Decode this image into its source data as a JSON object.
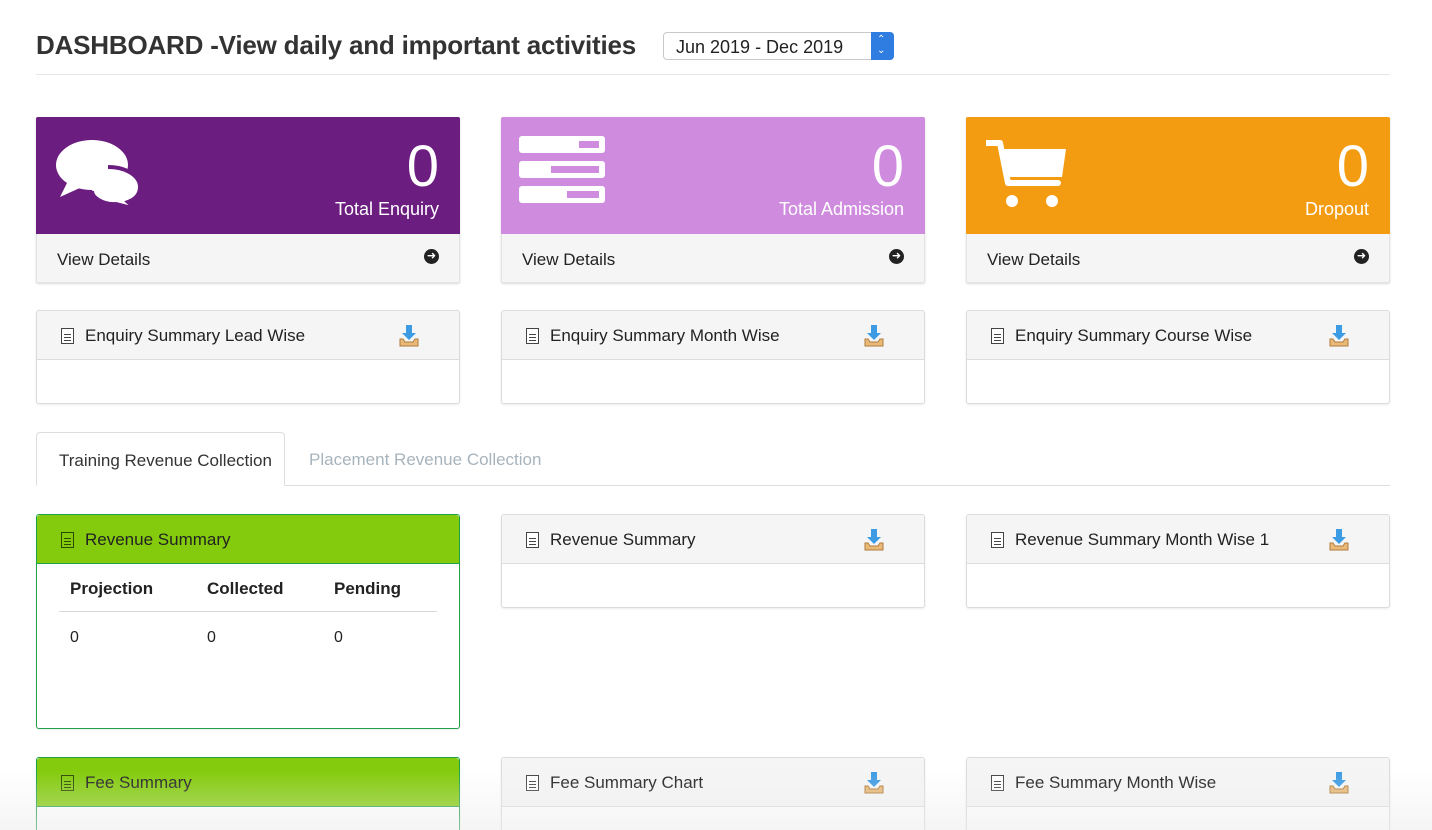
{
  "header": {
    "title": "DASHBOARD -View daily and important activities",
    "date_range": "Jun 2019 - Dec 2019"
  },
  "stats": [
    {
      "value": "0",
      "label": "Total Enquiry",
      "footer": "View Details",
      "color": "#6b1d80",
      "icon": "comments-icon"
    },
    {
      "value": "0",
      "label": "Total Admission",
      "footer": "View Details",
      "color": "#cf8bdd",
      "icon": "tasks-icon"
    },
    {
      "value": "0",
      "label": "Dropout",
      "footer": "View Details",
      "color": "#f39c12",
      "icon": "cart-icon"
    }
  ],
  "enquiry_panels": [
    {
      "title": "Enquiry Summary Lead Wise"
    },
    {
      "title": "Enquiry Summary Month Wise"
    },
    {
      "title": "Enquiry Summary Course Wise"
    }
  ],
  "tabs": [
    {
      "label": "Training Revenue Collection",
      "active": true
    },
    {
      "label": "Placement Revenue Collection",
      "active": false
    }
  ],
  "revenue_panels": [
    {
      "title": "Revenue Summary",
      "table": {
        "headers": [
          "Projection",
          "Collected",
          "Pending"
        ],
        "rows": [
          [
            "0",
            "0",
            "0"
          ]
        ]
      }
    },
    {
      "title": "Revenue Summary"
    },
    {
      "title": "Revenue Summary Month Wise 1"
    }
  ],
  "fee_panels": [
    {
      "title": "Fee Summary"
    },
    {
      "title": "Fee Summary Chart"
    },
    {
      "title": "Fee Summary Month Wise"
    }
  ],
  "colors": {
    "green_header": "#84cb0d",
    "green_border": "#1fa14a",
    "download_blue": "#3d9be3",
    "download_tray": "#e8b977"
  }
}
